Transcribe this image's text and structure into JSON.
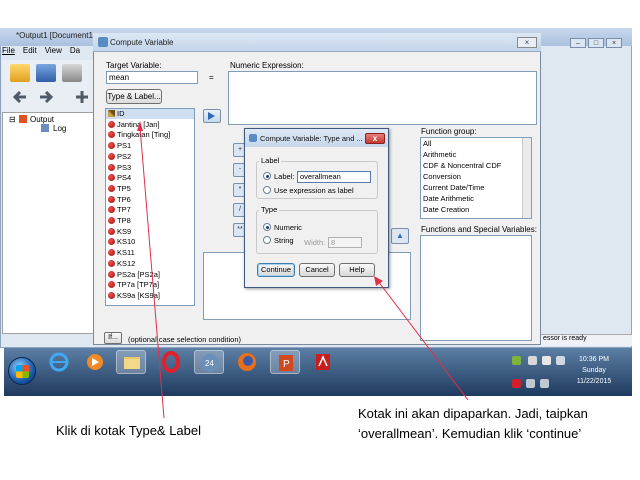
{
  "background_window": {
    "title": "*Output1 [Document1",
    "menu": [
      "File",
      "Edit",
      "View",
      "Da"
    ],
    "tree": {
      "root": "Output",
      "child": "Log"
    },
    "status_fragment": "essor is ready"
  },
  "compute_dialog": {
    "title": "Compute Variable",
    "target_label": "Target Variable:",
    "target_value": "mean",
    "equals": "=",
    "type_label_button": "Type & Label...",
    "numeric_expression_label": "Numeric Expression:",
    "variables": [
      "ID",
      "Jantina [Jan]",
      "Tingkatan [Ting]",
      "PS1",
      "PS2",
      "PS3",
      "PS4",
      "TP5",
      "TP6",
      "TP7",
      "TP8",
      "KS9",
      "KS10",
      "KS11",
      "KS12",
      "PS2a [PS2a]",
      "TP7a [TP7a]",
      "KS9a [KS9a]"
    ],
    "function_group_label": "Function group:",
    "function_groups": [
      "All",
      "Arithmetic",
      "CDF & Noncentral CDF",
      "Conversion",
      "Current Date/Time",
      "Date Arithmetic",
      "Date Creation"
    ],
    "special_label": "Functions and Special Variables:",
    "if_button": "If...",
    "if_text": "(optional case selection condition)"
  },
  "type_label_dialog": {
    "title": "Compute Variable: Type and ...",
    "close": "x",
    "label_group": "Label",
    "label_option": "Label:",
    "label_value": "overallmean",
    "use_expression": "Use expression as label",
    "type_group": "Type",
    "numeric": "Numeric",
    "string": "String",
    "width_label": "Width:",
    "width_value": "8",
    "continue": "Continue",
    "cancel": "Cancel",
    "help": "Help"
  },
  "taskbar": {
    "time": "10:36 PM",
    "day": "Sunday",
    "date": "11/22/2015"
  },
  "annotations": {
    "left": "Klik di kotak Type& Label",
    "right": "Kotak ini akan dipaparkan. Jadi, taipkan ‘overallmean’.  Kemudian klik ‘continue’"
  },
  "colors": {
    "dialog_bg": "#f0f0f0",
    "titlebar": "#c2d4ea",
    "arrow": "#e0304a",
    "taskbar": "#1e3a5e"
  }
}
